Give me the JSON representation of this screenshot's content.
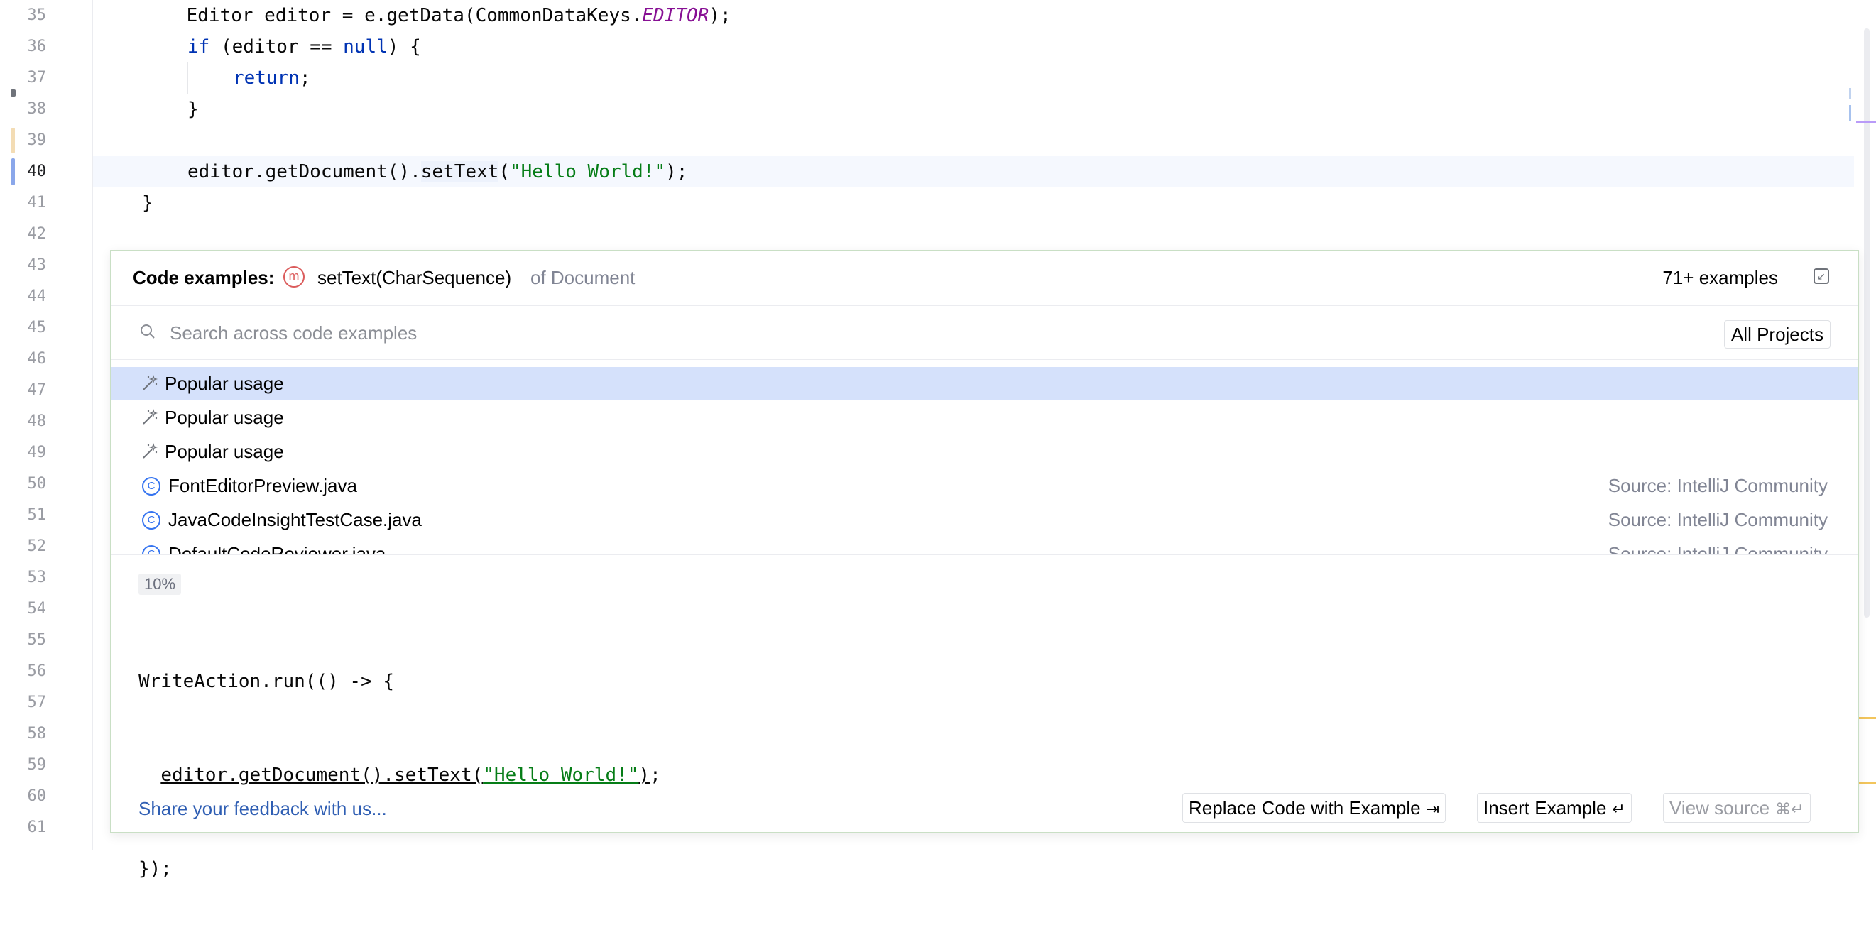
{
  "editor": {
    "line_numbers": [
      "35",
      "36",
      "37",
      "38",
      "39",
      "40",
      "41",
      "42",
      "43",
      "44",
      "45",
      "46",
      "47",
      "48",
      "49",
      "50",
      "51",
      "52",
      "53",
      "54",
      "55",
      "56",
      "57",
      "58",
      "59",
      "60",
      "61"
    ],
    "current_line": "40",
    "code": {
      "l35_a": "    Editor editor = e.getData(CommonDataKeys.",
      "l35_const": "EDITOR",
      "l35_b": ");",
      "l36_kw": "if",
      "l36_a": " (editor == ",
      "l36_null": "null",
      "l36_b": ") {",
      "l37_kw": "return",
      "l37_b": ";",
      "l38": "}",
      "l40_a": "editor.getDocument().",
      "l40_method": "setText",
      "l40_b": "(",
      "l40_str": "\"Hello World!\"",
      "l40_c": ");",
      "l41": "}"
    }
  },
  "popup": {
    "title": "Code examples:",
    "method_badge": "m",
    "method": "setText(CharSequence)",
    "of_class": "of Document",
    "count": "71+ examples",
    "search": {
      "placeholder": "Search across code examples",
      "scope": "All Projects"
    },
    "rows": [
      {
        "label": "Popular usage",
        "icon": "magic-wand-icon",
        "source": ""
      },
      {
        "label": "Popular usage",
        "icon": "magic-wand-icon",
        "source": ""
      },
      {
        "label": "Popular usage",
        "icon": "magic-wand-icon",
        "source": ""
      },
      {
        "label": "FontEditorPreview.java",
        "icon": "class-icon",
        "source": "Source: IntelliJ Community"
      },
      {
        "label": "JavaCodeInsightTestCase.java",
        "icon": "class-icon",
        "source": "Source: IntelliJ Community"
      },
      {
        "label": "DefaultCodeReviewer.java",
        "icon": "class-icon",
        "source": "Source: IntelliJ Community"
      }
    ],
    "class_badge": "C",
    "example": {
      "percent": "10%",
      "l1": "WriteAction.run(() -> {",
      "l2_a": "editor.getDocument().setText(",
      "l2_str": "\"Hello World!\"",
      "l2_b": ")",
      "l2_c": ";",
      "l3": "});"
    },
    "feedback": "Share your feedback with us...",
    "buttons": {
      "replace": "Replace Code with Example",
      "replace_shortcut": "⇥",
      "insert": "Insert Example",
      "insert_shortcut": "↵",
      "view_source": "View source",
      "view_source_shortcut": "⌘↵"
    }
  },
  "colors": {
    "keyword": "#0033b3",
    "string": "#067d17",
    "constant": "#871094",
    "selection": "#d5e1fb",
    "popup_border": "#c9dfc5",
    "link": "#2f5eb3"
  }
}
